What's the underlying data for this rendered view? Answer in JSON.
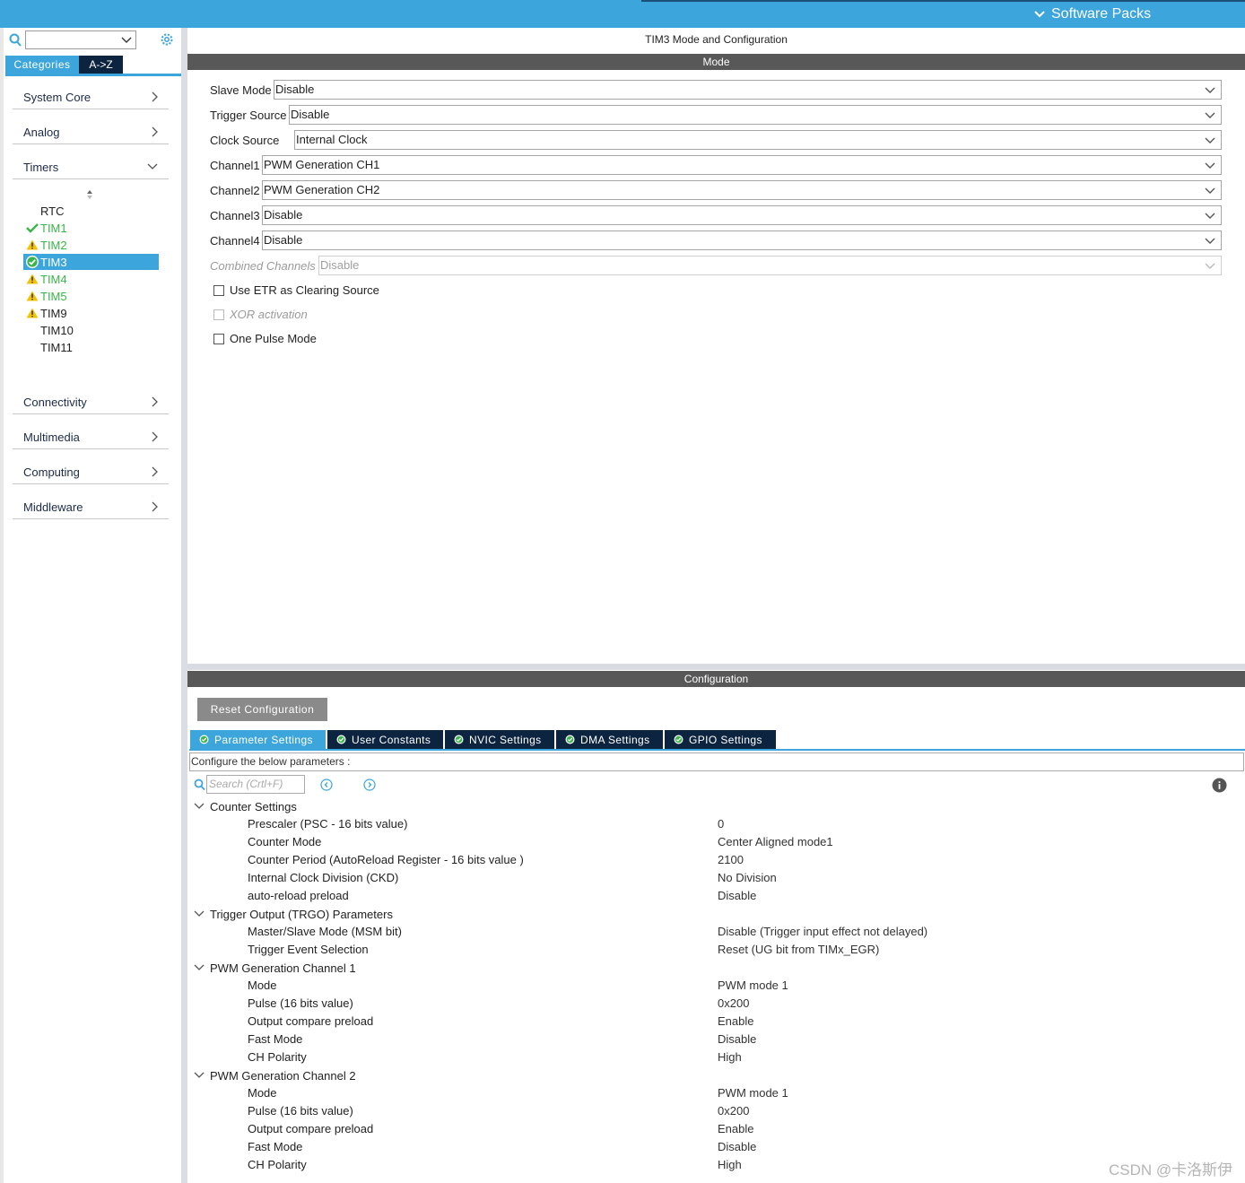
{
  "topbar": {
    "software_packs": "Software Packs"
  },
  "left": {
    "tabs": {
      "categories": "Categories",
      "az": "A->Z"
    },
    "categories_top": [
      {
        "label": "System Core"
      },
      {
        "label": "Analog"
      },
      {
        "label": "Timers"
      }
    ],
    "timers": [
      {
        "name": "RTC",
        "status": "none"
      },
      {
        "name": "TIM1",
        "status": "ok"
      },
      {
        "name": "TIM2",
        "status": "warning"
      },
      {
        "name": "TIM3",
        "status": "ok-selected"
      },
      {
        "name": "TIM4",
        "status": "warning"
      },
      {
        "name": "TIM5",
        "status": "warning"
      },
      {
        "name": "TIM9",
        "status": "warning"
      },
      {
        "name": "TIM10",
        "status": "none"
      },
      {
        "name": "TIM11",
        "status": "none"
      }
    ],
    "categories_bottom": [
      {
        "label": "Connectivity"
      },
      {
        "label": "Multimedia"
      },
      {
        "label": "Computing"
      },
      {
        "label": "Middleware"
      }
    ]
  },
  "main": {
    "title": "TIM3 Mode and Configuration",
    "mode_header": "Mode",
    "mode_rows": [
      {
        "label": "Slave Mode",
        "value": "Disable"
      },
      {
        "label": "Trigger Source",
        "value": "Disable"
      },
      {
        "label": "Clock Source",
        "value": "Internal Clock"
      },
      {
        "label": "Channel1",
        "value": "PWM Generation CH1"
      },
      {
        "label": "Channel2",
        "value": "PWM Generation CH2"
      },
      {
        "label": "Channel3",
        "value": "Disable"
      },
      {
        "label": "Channel4",
        "value": "Disable"
      },
      {
        "label": "Combined Channels",
        "value": "Disable"
      }
    ],
    "checkboxes": [
      {
        "label": "Use ETR as Clearing Source"
      },
      {
        "label": "XOR activation"
      },
      {
        "label": "One Pulse Mode"
      }
    ],
    "config_header": "Configuration",
    "reset_button": "Reset Configuration",
    "tabs": [
      {
        "label": "Parameter Settings"
      },
      {
        "label": "User Constants"
      },
      {
        "label": "NVIC Settings"
      },
      {
        "label": "DMA Settings"
      },
      {
        "label": "GPIO Settings"
      }
    ],
    "params_desc": "Configure the below parameters :",
    "search_placeholder": "Search (Crtl+F)",
    "groups": [
      {
        "name": "Counter Settings",
        "params": [
          {
            "name": "Prescaler (PSC - 16 bits value)",
            "value": "0"
          },
          {
            "name": "Counter Mode",
            "value": "Center Aligned mode1"
          },
          {
            "name": "Counter Period (AutoReload Register - 16 bits value )",
            "value": "2100"
          },
          {
            "name": "Internal Clock Division (CKD)",
            "value": "No Division"
          },
          {
            "name": "auto-reload preload",
            "value": "Disable"
          }
        ]
      },
      {
        "name": "Trigger Output (TRGO) Parameters",
        "params": [
          {
            "name": "Master/Slave Mode (MSM bit)",
            "value": "Disable (Trigger input effect not delayed)"
          },
          {
            "name": "Trigger Event Selection",
            "value": "Reset (UG bit from TIMx_EGR)"
          }
        ]
      },
      {
        "name": "PWM Generation Channel 1",
        "params": [
          {
            "name": "Mode",
            "value": "PWM mode 1"
          },
          {
            "name": "Pulse (16 bits value)",
            "value": "0x200"
          },
          {
            "name": "Output compare preload",
            "value": "Enable"
          },
          {
            "name": "Fast Mode",
            "value": "Disable"
          },
          {
            "name": "CH Polarity",
            "value": "High"
          }
        ]
      },
      {
        "name": "PWM Generation Channel 2",
        "params": [
          {
            "name": "Mode",
            "value": "PWM mode 1"
          },
          {
            "name": "Pulse (16 bits value)",
            "value": "0x200"
          },
          {
            "name": "Output compare preload",
            "value": "Enable"
          },
          {
            "name": "Fast Mode",
            "value": "Disable"
          },
          {
            "name": "CH Polarity",
            "value": "High"
          }
        ]
      }
    ]
  },
  "watermark": "CSDN @卡洛斯伊",
  "colors": {
    "accent": "#3ca5dc",
    "dark_tab": "#0d2440",
    "ok_green": "#39b54a",
    "warning_yellow": "#f4c300",
    "section_gray": "#585858"
  }
}
